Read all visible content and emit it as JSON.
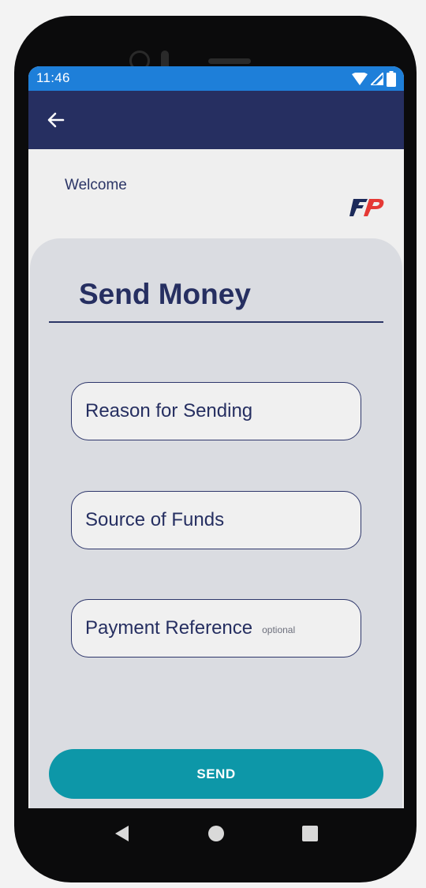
{
  "status_bar": {
    "time": "11:46",
    "icons": [
      "wifi-icon",
      "signal-icon",
      "battery-icon"
    ]
  },
  "app_bar": {
    "back_icon": "arrow-left-icon"
  },
  "header": {
    "welcome": "Welcome",
    "logo_text": "FP"
  },
  "form": {
    "title": "Send Money",
    "fields": [
      {
        "label": "Reason for Sending",
        "hint": ""
      },
      {
        "label": "Source of Funds",
        "hint": ""
      },
      {
        "label": "Payment Reference",
        "hint": "optional"
      }
    ],
    "submit_label": "SEND"
  },
  "nav_bar": {
    "buttons": [
      "back-triangle-icon",
      "home-circle-icon",
      "recents-square-icon"
    ]
  },
  "colors": {
    "status_bar": "#1e7fd9",
    "app_bar": "#262f61",
    "card": "#dadce1",
    "field_border": "#2e376b",
    "send_button": "#0d97a8",
    "logo_red": "#e53935"
  }
}
